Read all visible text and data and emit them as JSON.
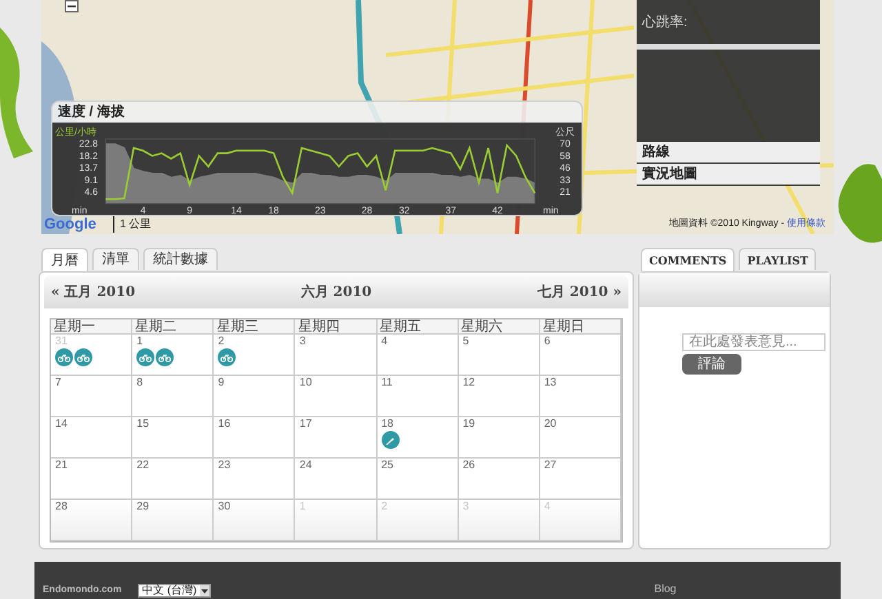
{
  "map": {
    "heart_rate_label": "心跳率:",
    "panel_items": [
      {
        "label": "路線"
      },
      {
        "label": "實況地圖"
      }
    ],
    "logo": "Google",
    "scale": "1 公里",
    "attribution": "地圖資料 ©2010 Kingway - ",
    "terms_link": "使用條款"
  },
  "speed_chart": {
    "title": "速度 / 海拔",
    "x_end_label": "min",
    "y2label": "公尺",
    "right_yticks": [
      "70",
      "58",
      "46",
      "33",
      "21"
    ],
    "chart_data": {
      "type": "line",
      "xlabel": "min",
      "ylabel": "公里/小時",
      "xlim": [
        0,
        46
      ],
      "ylim": [
        0,
        24.4
      ],
      "xticks": [
        4,
        9,
        14,
        18,
        23,
        28,
        32,
        37,
        42
      ],
      "yticks": [
        {
          "value": 4.6,
          "label": "4.6"
        },
        {
          "value": 9.1,
          "label": "9.1"
        },
        {
          "value": 13.7,
          "label": "13.7"
        },
        {
          "value": 18.2,
          "label": "18.2"
        },
        {
          "value": 22.8,
          "label": "22.8"
        }
      ],
      "x": [
        0,
        1,
        2,
        3,
        4,
        5,
        6,
        7,
        8,
        9,
        10,
        11,
        12,
        13,
        14,
        15,
        16,
        17,
        18,
        19,
        20,
        21,
        22,
        23,
        24,
        25,
        26,
        27,
        28,
        29,
        30,
        31,
        32,
        33,
        34,
        35,
        36,
        37,
        38,
        39,
        40,
        41,
        42,
        43,
        44,
        45,
        46
      ],
      "series": [
        {
          "color": "#9acd32",
          "values": [
            1.7,
            1.7,
            2,
            21,
            20,
            18,
            19,
            17,
            19,
            7,
            18,
            14,
            19,
            19,
            20,
            20,
            20,
            20,
            19,
            10,
            4,
            21,
            20,
            19,
            18,
            14,
            18,
            19,
            14,
            18,
            5,
            20,
            20,
            20,
            20,
            21,
            20,
            19,
            13,
            21,
            8,
            21,
            4,
            22,
            18,
            10,
            4
          ]
        }
      ]
    }
  },
  "tabs": [
    {
      "label": "月曆",
      "selected": true
    },
    {
      "label": "清單",
      "selected": false
    },
    {
      "label": "統計數據",
      "selected": false
    }
  ],
  "calendar": {
    "prev": "« 五月 2010",
    "current": "六月 2010",
    "next": "七月 2010 »",
    "weekdays": [
      "星期一",
      "星期二",
      "星期三",
      "星期四",
      "星期五",
      "星期六",
      "星期日"
    ],
    "weeks": [
      [
        {
          "day": "31",
          "muted": true,
          "workouts": [
            {
              "kind": "cycling"
            },
            {
              "kind": "cycling"
            }
          ]
        },
        {
          "day": "1",
          "muted": false,
          "workouts": [
            {
              "kind": "cycling"
            },
            {
              "kind": "cycling"
            }
          ]
        },
        {
          "day": "2",
          "muted": false,
          "workouts": [
            {
              "kind": "cycling"
            }
          ]
        },
        {
          "day": "3",
          "muted": false
        },
        {
          "day": "4",
          "muted": false
        },
        {
          "day": "5",
          "muted": false
        },
        {
          "day": "6",
          "muted": false
        }
      ],
      [
        {
          "day": "7",
          "muted": false
        },
        {
          "day": "8",
          "muted": false
        },
        {
          "day": "9",
          "muted": false
        },
        {
          "day": "10",
          "muted": false
        },
        {
          "day": "11",
          "muted": false
        },
        {
          "day": "12",
          "muted": false
        },
        {
          "day": "13",
          "muted": false
        }
      ],
      [
        {
          "day": "14",
          "muted": false
        },
        {
          "day": "15",
          "muted": false
        },
        {
          "day": "16",
          "muted": false
        },
        {
          "day": "17",
          "muted": false
        },
        {
          "day": "18",
          "muted": false,
          "workouts": [
            {
              "kind": "other"
            }
          ]
        },
        {
          "day": "19",
          "muted": false
        },
        {
          "day": "20",
          "muted": false
        }
      ],
      [
        {
          "day": "21",
          "muted": false
        },
        {
          "day": "22",
          "muted": false
        },
        {
          "day": "23",
          "muted": false
        },
        {
          "day": "24",
          "muted": false
        },
        {
          "day": "25",
          "muted": false
        },
        {
          "day": "26",
          "muted": false
        },
        {
          "day": "27",
          "muted": false
        }
      ],
      [
        {
          "day": "28",
          "muted": false
        },
        {
          "day": "29",
          "muted": false
        },
        {
          "day": "30",
          "muted": false
        },
        {
          "day": "1",
          "muted": true
        },
        {
          "day": "2",
          "muted": true
        },
        {
          "day": "3",
          "muted": true
        },
        {
          "day": "4",
          "muted": true
        }
      ]
    ]
  },
  "side_tabs": [
    {
      "label": "COMMENTS",
      "selected": true
    },
    {
      "label": "PLAYLIST",
      "selected": false
    }
  ],
  "comment": {
    "placeholder": "在此處發表意見...",
    "button": "評論"
  },
  "footer": {
    "site": "Endomondo.com",
    "language": "中文 (台灣)",
    "links": [
      "Blog"
    ]
  }
}
